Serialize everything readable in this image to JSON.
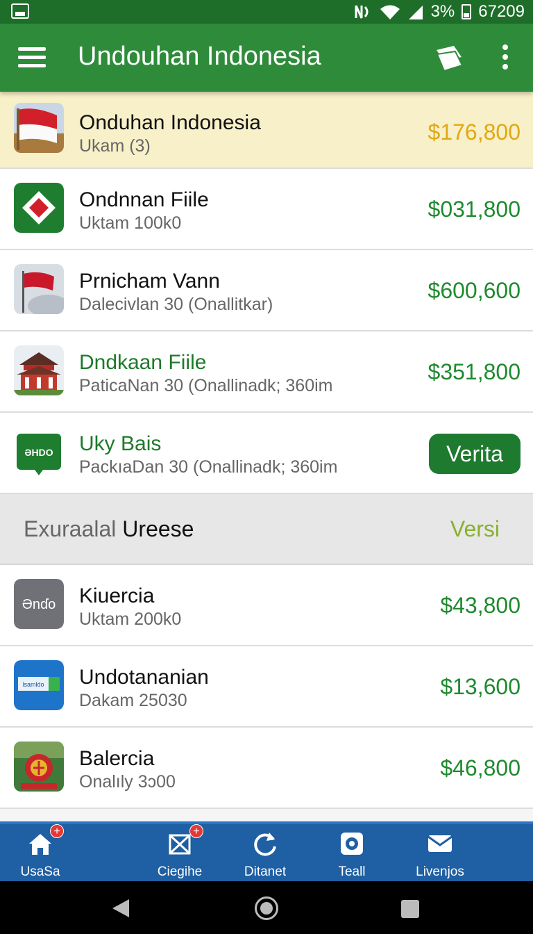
{
  "status_bar": {
    "battery_text": "3%",
    "clock": "67209"
  },
  "app_bar": {
    "title": "Undouhan Indonesia"
  },
  "items": [
    {
      "title": "Onduhan Indonesia",
      "subtitle": "Ukam (3)",
      "price": "$176,800",
      "icon": "indonesia-flag-icon",
      "highlighted": true
    },
    {
      "title": "Ondnnan Fiile",
      "subtitle": "Uktam 100k0",
      "price": "$031,800",
      "icon": "green-diamond-icon"
    },
    {
      "title": "Prnicham Vann",
      "subtitle": "Dalecivlan 30 (Onallitkar)",
      "price": "$600,600",
      "icon": "red-flag-icon"
    },
    {
      "title": "Dndkaan Fiile",
      "subtitle": "PaticaNan 30 (Onallinadk; 360im",
      "price": "$351,800",
      "icon": "temple-icon"
    },
    {
      "title": "Uky Bais",
      "subtitle": "PackıaDan 30 (Onallinadk; 360im",
      "action": "Verita",
      "icon": "hdo-icon",
      "icon_text": "ƏHDO"
    }
  ],
  "section": {
    "title_light": "Exuraalal",
    "title_dark": "Ureese",
    "action": "Versi"
  },
  "items2": [
    {
      "title": "Kiuercia",
      "subtitle": "Uktam 200k0",
      "price": "$43,800",
      "icon": "ondo-icon",
      "icon_text": "Ənɗo"
    },
    {
      "title": "Undotananian",
      "subtitle": "Dakam 25030",
      "price": "$13,600",
      "icon": "banner-icon",
      "icon_text": "lsamldo"
    },
    {
      "title": "Balercia",
      "subtitle": "Onalıly 3ɔ00",
      "price": "$46,800",
      "icon": "emblem-icon"
    }
  ],
  "bottom_nav": [
    {
      "label": "UsaSa",
      "icon": "home-icon",
      "badge": "+"
    },
    {
      "label": "Ciegihe",
      "icon": "tools-icon",
      "badge": "+"
    },
    {
      "label": "Ditanet",
      "icon": "refresh-icon"
    },
    {
      "label": "Teall",
      "icon": "camera-icon"
    },
    {
      "label": "Livenjos",
      "icon": "mail-icon"
    }
  ],
  "colors": {
    "status_bar": "#1e6e2a",
    "app_bar": "#2e8b3a",
    "price_green": "#1e8a2e",
    "price_gold": "#e2a812",
    "bottom_nav": "#1f5fa3"
  }
}
